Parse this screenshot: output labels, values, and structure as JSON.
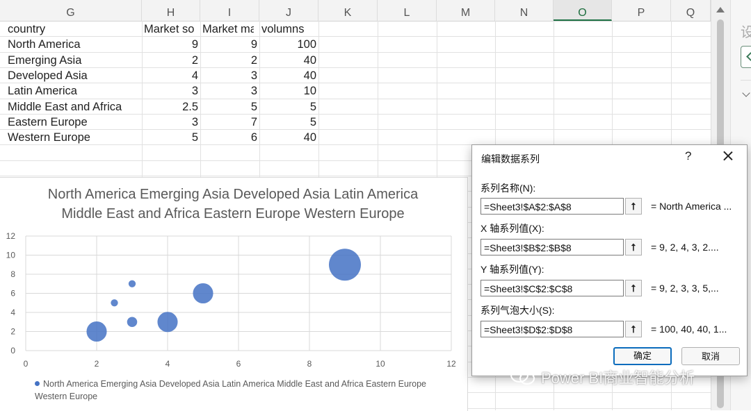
{
  "columns": [
    "G",
    "H",
    "I",
    "J",
    "K",
    "L",
    "M",
    "N",
    "O",
    "P",
    "Q"
  ],
  "selected_column": "O",
  "table": {
    "headers": [
      "country",
      "Market sop",
      "Market ma",
      "volumns"
    ],
    "rows": [
      [
        "North America",
        "9",
        "9",
        "100"
      ],
      [
        "Emerging Asia",
        "2",
        "2",
        "40"
      ],
      [
        "Developed Asia",
        "4",
        "3",
        "40"
      ],
      [
        "Latin America",
        "3",
        "3",
        "10"
      ],
      [
        "Middle East and Africa",
        "2.5",
        "5",
        "5"
      ],
      [
        "Eastern Europe",
        "3",
        "7",
        "5"
      ],
      [
        "Western Europe",
        "5",
        "6",
        "40"
      ]
    ]
  },
  "chart_data": {
    "type": "scatter",
    "title_lines": [
      "North America Emerging Asia Developed Asia Latin America",
      "Middle East and Africa Eastern Europe Western Europe"
    ],
    "series": [
      {
        "name": "North America Emerging Asia Developed Asia Latin America Middle East and Africa Eastern Europe Western Europe",
        "x": [
          9,
          2,
          4,
          3,
          2.5,
          3,
          5
        ],
        "y": [
          9,
          2,
          3,
          3,
          5,
          7,
          6
        ],
        "size": [
          100,
          40,
          40,
          10,
          5,
          5,
          40
        ]
      }
    ],
    "xlim": [
      0,
      12
    ],
    "ylim": [
      0,
      12
    ],
    "xticks": [
      0,
      2,
      4,
      6,
      8,
      10,
      12
    ],
    "yticks": [
      0,
      2,
      4,
      6,
      8,
      10,
      12
    ],
    "grid": true,
    "legend_position": "bottom",
    "color": "#4472c4"
  },
  "dialog": {
    "title": "编辑数据系列",
    "help": "?",
    "fields": [
      {
        "label": "系列名称(N):",
        "value": "=Sheet3!$A$2:$A$8",
        "preview": "= North America ..."
      },
      {
        "label": "X 轴系列值(X):",
        "value": "=Sheet3!$B$2:$B$8",
        "preview": "= 9, 2, 4, 3, 2...."
      },
      {
        "label": "Y 轴系列值(Y):",
        "value": "=Sheet3!$C$2:$C$8",
        "preview": "= 9, 2, 3, 3, 5,..."
      },
      {
        "label": "系列气泡大小(S):",
        "value": "=Sheet3!$D$2:$D$8",
        "preview": "= 100, 40, 40, 1..."
      }
    ],
    "ok": "确定",
    "cancel": "取消"
  },
  "side_panel": {
    "title_glyph": "设"
  },
  "watermark": "Power BI商业智能分析"
}
